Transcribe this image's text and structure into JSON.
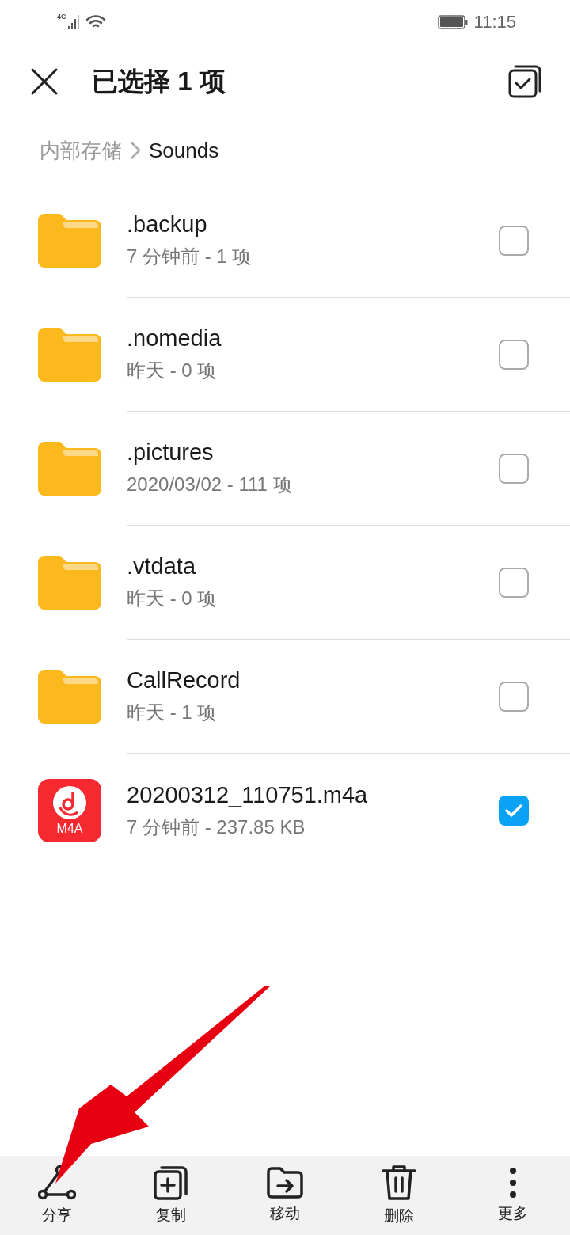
{
  "status_bar": {
    "network": "4G",
    "time": "11:15"
  },
  "header": {
    "title": "已选择 1 项"
  },
  "breadcrumb": [
    "内部存储",
    "Sounds"
  ],
  "files": [
    {
      "kind": "folder",
      "name": ".backup",
      "meta": "7 分钟前 - 1 项",
      "checked": false
    },
    {
      "kind": "folder",
      "name": ".nomedia",
      "meta": "昨天 - 0 项",
      "checked": false
    },
    {
      "kind": "folder",
      "name": ".pictures",
      "meta": "2020/03/02 - 111 项",
      "checked": false
    },
    {
      "kind": "folder",
      "name": ".vtdata",
      "meta": "昨天 - 0 项",
      "checked": false
    },
    {
      "kind": "folder",
      "name": "CallRecord",
      "meta": "昨天 - 1 项",
      "checked": false
    },
    {
      "kind": "audio",
      "name": "20200312_110751.m4a",
      "meta": "7 分钟前 - 237.85 KB",
      "badge": "M4A",
      "checked": true
    }
  ],
  "toolbar": [
    {
      "kind": "share",
      "label": "分享"
    },
    {
      "kind": "copy",
      "label": "复制"
    },
    {
      "kind": "move",
      "label": "移动"
    },
    {
      "kind": "delete",
      "label": "删除"
    },
    {
      "kind": "more",
      "label": "更多"
    }
  ]
}
